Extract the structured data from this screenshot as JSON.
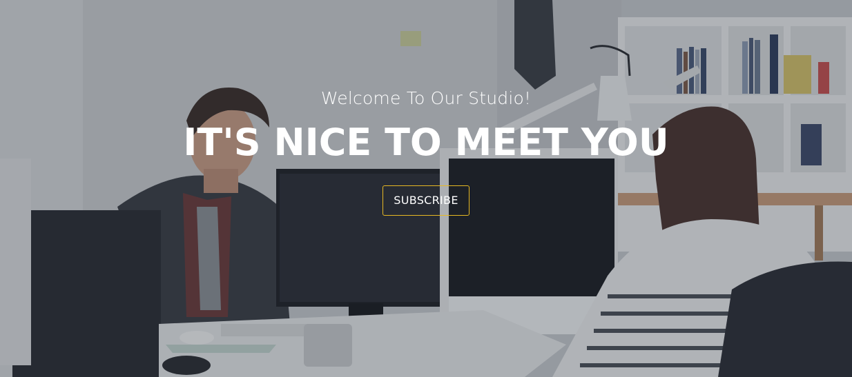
{
  "hero": {
    "subtitle": "Welcome To Our Studio!",
    "headline": "IT'S NICE TO MEET YOU",
    "cta_label": "SUBSCRIBE",
    "accent_color": "#e8b923",
    "background_image": "office-studio-photo"
  }
}
